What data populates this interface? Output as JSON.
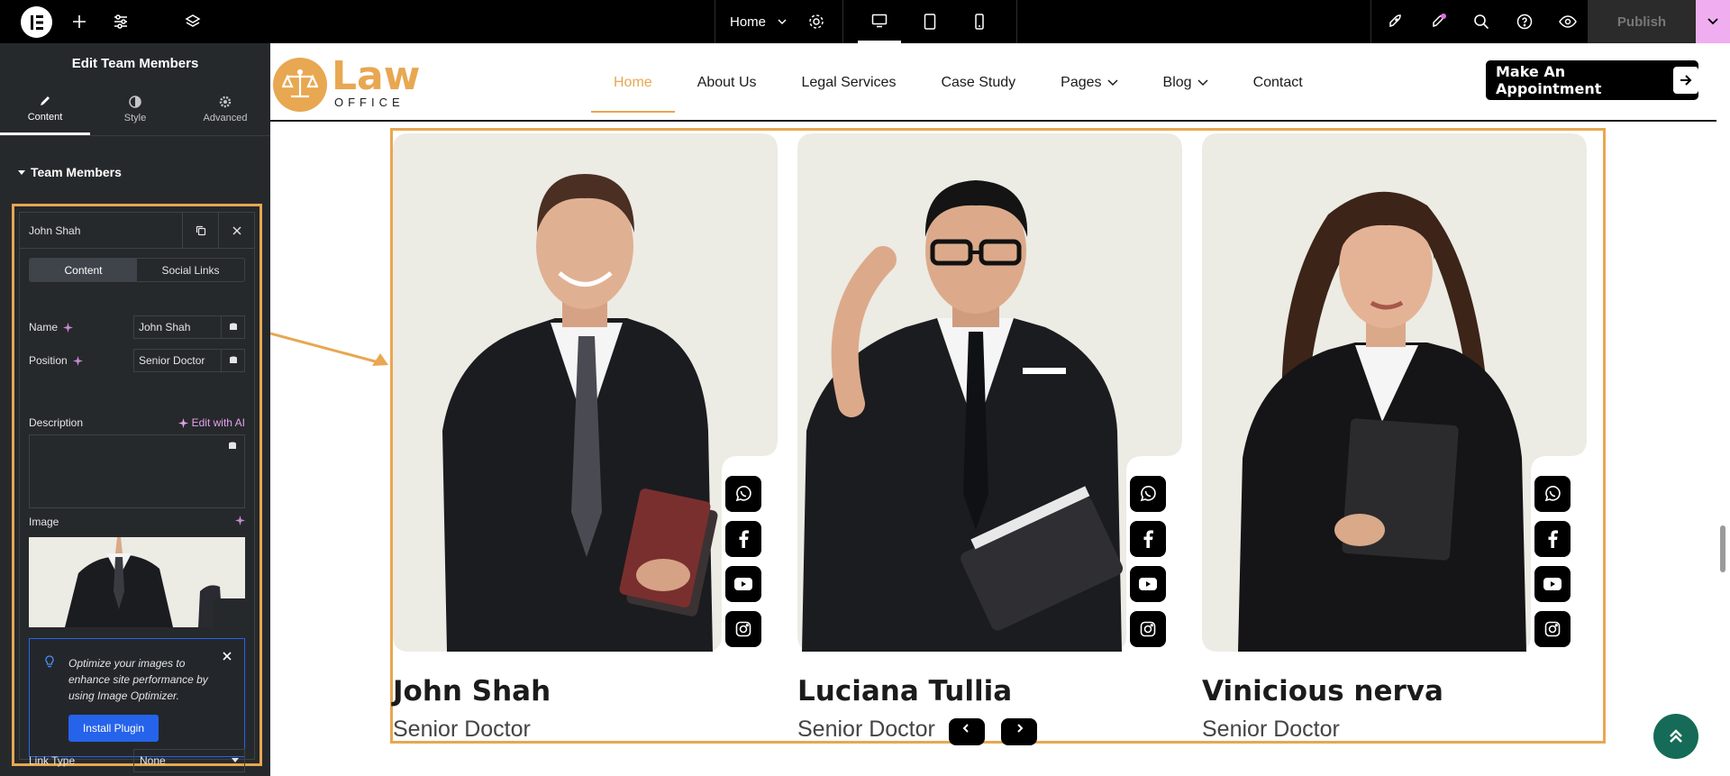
{
  "topbar": {
    "page_name": "Home",
    "publish_label": "Publish"
  },
  "panel": {
    "title": "Edit Team Members",
    "tabs": [
      {
        "label": "Content"
      },
      {
        "label": "Style"
      },
      {
        "label": "Advanced"
      }
    ],
    "section_title": "Team Members",
    "item": {
      "title": "John Shah",
      "inner_tabs": [
        "Content",
        "Social Links"
      ],
      "name_label": "Name",
      "name_value": "John Shah",
      "position_label": "Position",
      "position_value": "Senior Doctor",
      "description_label": "Description",
      "edit_ai_label": "Edit with AI",
      "image_label": "Image",
      "notice_text": "Optimize your images to enhance site performance by using Image Optimizer.",
      "install_label": "Install Plugin",
      "link_type_label": "Link Type",
      "link_type_value": "None"
    }
  },
  "site": {
    "brand_word": "Law",
    "brand_sub": "OFFICE",
    "nav": [
      {
        "label": "Home"
      },
      {
        "label": "About Us"
      },
      {
        "label": "Legal Services"
      },
      {
        "label": "Case Study"
      },
      {
        "label": "Pages"
      },
      {
        "label": "Blog"
      },
      {
        "label": "Contact"
      }
    ],
    "cta_label": "Make An Appointment"
  },
  "team": [
    {
      "name": "John Shah",
      "position": "Senior Doctor"
    },
    {
      "name": "Luciana Tullia",
      "position": "Senior Doctor"
    },
    {
      "name": "Vinicious nerva",
      "position": "Senior Doctor"
    }
  ],
  "colors": {
    "accent": "#e8a751",
    "panel_bg": "#26292c",
    "photo_bg": "#ecebe4",
    "back_to_top": "#156b57",
    "install_button": "#2563eb"
  }
}
